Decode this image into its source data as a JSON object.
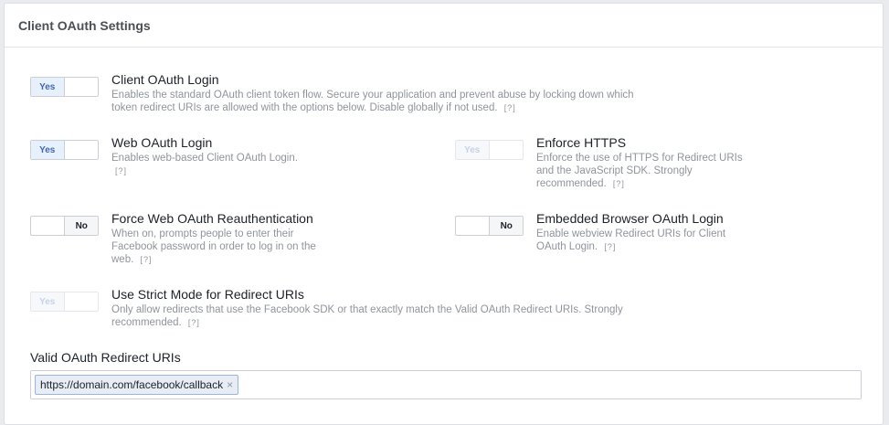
{
  "panel": {
    "title": "Client OAuth Settings"
  },
  "settings": {
    "client_oauth_login": {
      "toggle": "Yes",
      "title": "Client OAuth Login",
      "desc": "Enables the standard OAuth client token flow. Secure your application and prevent abuse by locking down which token redirect URIs are allowed with the options below. Disable globally if not used.",
      "help": "[?]"
    },
    "web_oauth_login": {
      "toggle": "Yes",
      "title": "Web OAuth Login",
      "desc": "Enables web-based Client OAuth Login.",
      "help": "[?]"
    },
    "enforce_https": {
      "toggle": "Yes",
      "title": "Enforce HTTPS",
      "desc": "Enforce the use of HTTPS for Redirect URIs and the JavaScript SDK. Strongly recommended.",
      "help": "[?]"
    },
    "force_reauth": {
      "toggle": "No",
      "title": "Force Web OAuth Reauthentication",
      "desc": "When on, prompts people to enter their Facebook password in order to log in on the web.",
      "help": "[?]"
    },
    "embedded_browser": {
      "toggle": "No",
      "title": "Embedded Browser OAuth Login",
      "desc": "Enable webview Redirect URIs for Client OAuth Login.",
      "help": "[?]"
    },
    "strict_mode": {
      "toggle": "Yes",
      "title": "Use Strict Mode for Redirect URIs",
      "desc": "Only allow redirects that use the Facebook SDK or that exactly match the Valid OAuth Redirect URIs. Strongly recommended.",
      "help": "[?]"
    }
  },
  "redirect_uris": {
    "label": "Valid OAuth Redirect URIs",
    "tags": [
      "https://domain.com/facebook/callback"
    ],
    "remove_glyph": "×"
  }
}
